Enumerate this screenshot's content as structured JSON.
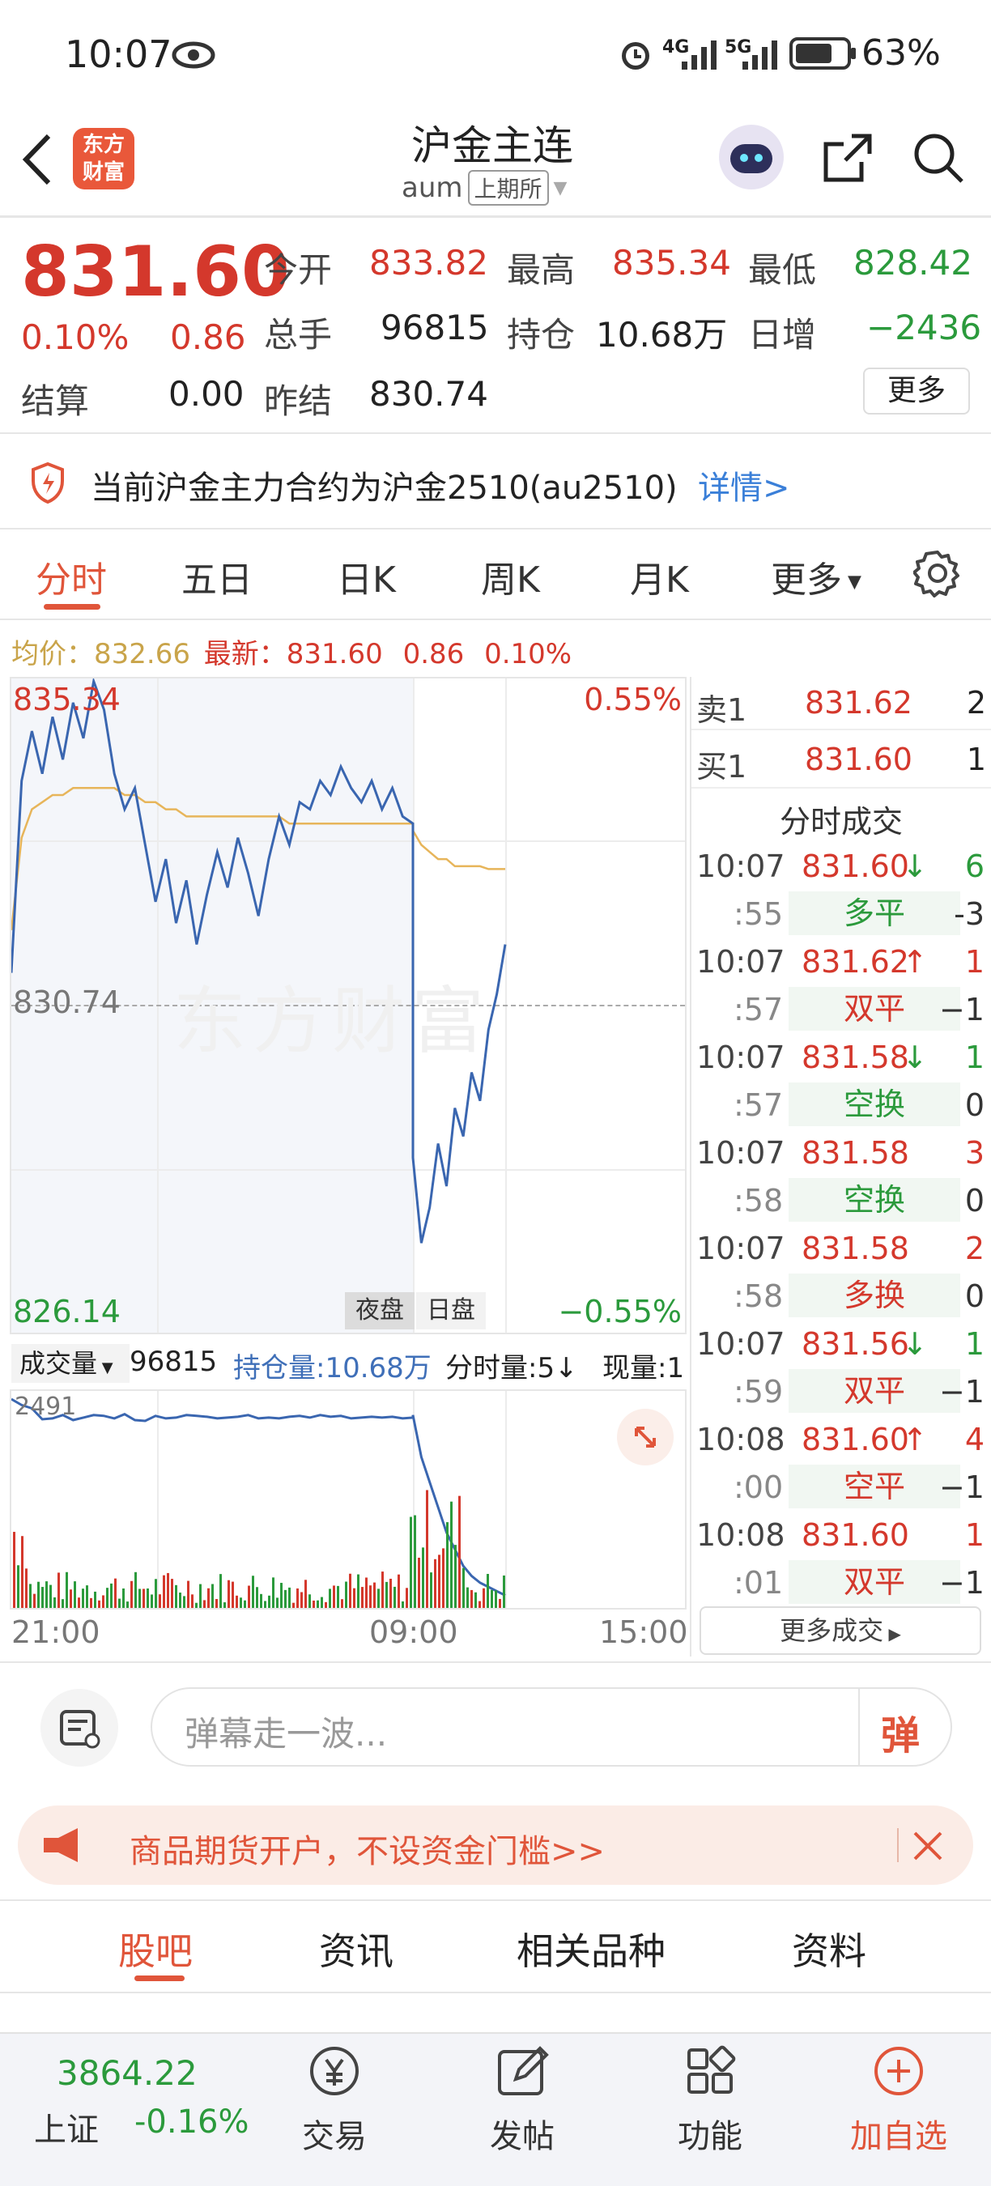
{
  "status_bar": {
    "time": "10:07",
    "signal_4g": "4G",
    "signal_5g": "5G",
    "battery": "63%"
  },
  "header": {
    "title": "沪金主连",
    "code": "aum",
    "exchange": "上期所",
    "logo_text_1": "东方",
    "logo_text_2": "财富"
  },
  "quote": {
    "price": "831.60",
    "pct": "0.10%",
    "chg": "0.86",
    "open_label": "今开",
    "open": "833.82",
    "high_label": "最高",
    "high": "835.34",
    "low_label": "最低",
    "low": "828.42",
    "volume_label": "总手",
    "volume": "96815",
    "oi_label": "持仓",
    "oi": "10.68万",
    "daily_add_label": "日增",
    "daily_add": "−2436",
    "settle_label": "结算",
    "settle": "0.00",
    "prev_settle_label": "昨结",
    "prev_settle": "830.74",
    "more_button": "更多"
  },
  "notice": {
    "text": "当前沪金主力合约为沪金2510(au2510)",
    "link": "详情>"
  },
  "tabs": [
    "分时",
    "五日",
    "日K",
    "周K",
    "月K",
    "更多"
  ],
  "avg_line": {
    "avg_label": "均价：",
    "avg_value": "832.66",
    "last_label": "最新：",
    "last_value": "831.60",
    "chg": "0.86",
    "pct": "0.10%"
  },
  "chart_data": {
    "type": "line",
    "y_max_label": "835.34",
    "y_mid_label": "830.74",
    "y_min_label": "826.14",
    "pct_max_label": "0.55%",
    "pct_min_label": "−0.55%",
    "session_labels": [
      "夜盘",
      "日盘"
    ],
    "x_ticks": [
      "21:00",
      "09:00",
      "15:00"
    ],
    "ylim": [
      826.14,
      835.34
    ],
    "prev_settle": 830.74,
    "price_series": [
      831.2,
      833.9,
      834.6,
      834.0,
      834.8,
      834.2,
      835.0,
      834.5,
      835.3,
      834.9,
      834.0,
      833.5,
      833.8,
      833.0,
      832.2,
      832.8,
      831.9,
      832.5,
      831.6,
      832.3,
      832.9,
      832.4,
      833.1,
      832.6,
      832.0,
      832.8,
      833.4,
      833.0,
      833.6,
      833.5,
      833.9,
      833.7,
      834.1,
      833.8,
      833.6,
      833.9,
      833.5,
      833.8,
      833.4,
      833.3,
      828.6,
      827.4,
      827.9,
      828.8,
      828.2,
      829.3,
      828.9,
      829.8,
      829.4,
      830.4,
      830.9,
      831.6
    ],
    "avg_series": [
      831.8,
      833.1,
      833.5,
      833.6,
      833.7,
      833.7,
      833.8,
      833.8,
      833.8,
      833.8,
      833.8,
      833.7,
      833.7,
      833.6,
      833.6,
      833.5,
      833.5,
      833.4,
      833.4,
      833.4,
      833.4,
      833.4,
      833.4,
      833.4,
      833.4,
      833.4,
      833.4,
      833.3,
      833.3,
      833.3,
      833.3,
      833.3,
      833.3,
      833.3,
      833.3,
      833.3,
      833.3,
      833.3,
      833.3,
      833.3,
      833.2,
      833.0,
      832.9,
      832.8,
      832.8,
      832.7,
      832.7,
      832.7,
      832.7,
      832.66,
      832.66,
      832.66
    ],
    "volume_series": [
      2491,
      2420,
      2380,
      2250,
      2260,
      2300,
      2240,
      2270,
      2300,
      2290,
      2260,
      2310,
      2240,
      2230,
      2290,
      2260,
      2270,
      2300,
      2290,
      2280,
      2260,
      2270,
      2280,
      2300,
      2260,
      2270,
      2260,
      2280,
      2290,
      2270,
      2300,
      2280,
      2290,
      2260,
      2270,
      2280,
      2270,
      2280,
      2260,
      2270,
      2300,
      1800,
      1500,
      1200,
      900,
      700,
      500,
      380,
      300,
      250,
      200,
      150
    ]
  },
  "volume_bar": {
    "label": "成交量",
    "value": "96815",
    "oi_label": "持仓量:10.68万",
    "tick_label": "分时量:5↓",
    "now_label": "现量:1",
    "max_label": "2491"
  },
  "order_book": {
    "ask_label": "卖1",
    "ask_price": "831.62",
    "ask_qty": "2",
    "bid_label": "买1",
    "bid_price": "831.60",
    "bid_qty": "1",
    "title": "分时成交"
  },
  "trades": [
    {
      "time": "10:07",
      "price": "831.60",
      "arrow": "↓",
      "qty": "6",
      "sec": ":55",
      "type": "多平",
      "delta": "-3"
    },
    {
      "time": "10:07",
      "price": "831.62",
      "arrow": "↑",
      "qty": "1",
      "sec": ":57",
      "type": "双平",
      "delta": "−1"
    },
    {
      "time": "10:07",
      "price": "831.58",
      "arrow": "↓",
      "qty": "1",
      "sec": ":57",
      "type": "空换",
      "delta": "0"
    },
    {
      "time": "10:07",
      "price": "831.58",
      "arrow": "",
      "qty": "3",
      "sec": ":58",
      "type": "空换",
      "delta": "0"
    },
    {
      "time": "10:07",
      "price": "831.58",
      "arrow": "",
      "qty": "2",
      "sec": ":58",
      "type": "多换",
      "delta": "0"
    },
    {
      "time": "10:07",
      "price": "831.56",
      "arrow": "↓",
      "qty": "1",
      "sec": ":59",
      "type": "双平",
      "delta": "−1"
    },
    {
      "time": "10:08",
      "price": "831.60",
      "arrow": "↑",
      "qty": "4",
      "sec": ":00",
      "type": "空平",
      "delta": "−1"
    },
    {
      "time": "10:08",
      "price": "831.60",
      "arrow": "",
      "qty": "1",
      "sec": ":01",
      "type": "双平",
      "delta": "−1"
    }
  ],
  "more_trades": "更多成交",
  "danmu": {
    "placeholder": "弹幕走一波...",
    "send": "弹"
  },
  "ad": {
    "text": "商品期货开户，不设资金门槛>>"
  },
  "bottom_tabs": [
    "股吧",
    "资讯",
    "相关品种",
    "资料"
  ],
  "index": {
    "value": "3864.22",
    "name": "上证",
    "pct": "-0.16%"
  },
  "nav": [
    "交易",
    "发帖",
    "功能",
    "加自选"
  ]
}
